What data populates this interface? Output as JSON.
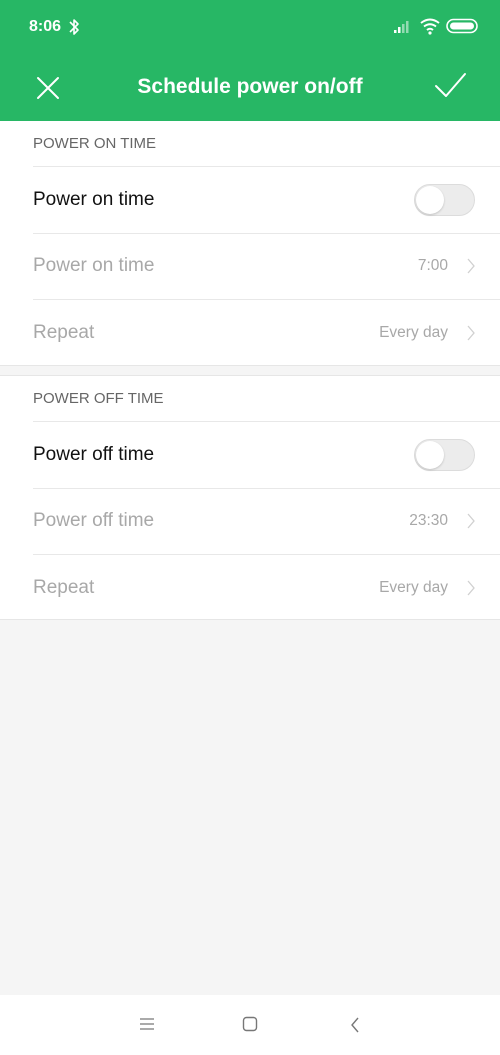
{
  "status_bar": {
    "time": "8:06",
    "icons": [
      "bluetooth-icon",
      "signal-icon",
      "wifi-icon",
      "battery-icon"
    ]
  },
  "header": {
    "title": "Schedule power on/off",
    "close_icon": "close-icon",
    "confirm_icon": "check-icon",
    "background_color": "#27b765"
  },
  "power_on": {
    "section_title": "POWER ON TIME",
    "toggle_label": "Power on time",
    "toggle_enabled": false,
    "time_label": "Power on time",
    "time_value": "7:00",
    "repeat_label": "Repeat",
    "repeat_value": "Every day"
  },
  "power_off": {
    "section_title": "POWER OFF TIME",
    "toggle_label": "Power off time",
    "toggle_enabled": false,
    "time_label": "Power off time",
    "time_value": "23:30",
    "repeat_label": "Repeat",
    "repeat_value": "Every day"
  },
  "system_nav": {
    "icons": [
      "menu-icon",
      "home-icon",
      "back-icon"
    ]
  }
}
